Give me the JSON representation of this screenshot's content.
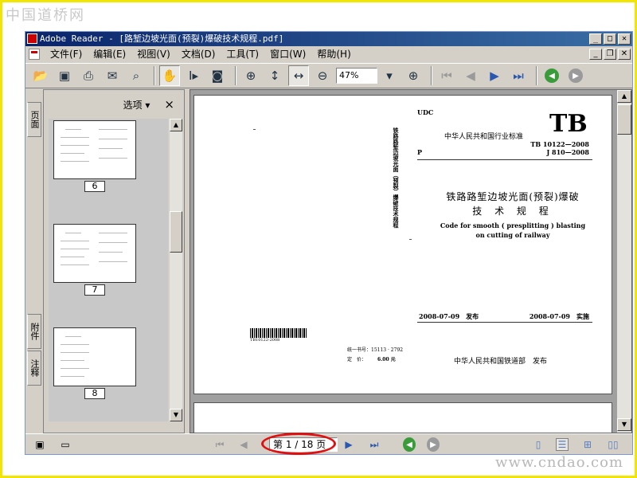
{
  "watermarks": {
    "top": "中国道桥网",
    "bottom": "www.cndao.com"
  },
  "window": {
    "title": "Adobe Reader - [路堑边坡光面(预裂)爆破技术规程.pdf]"
  },
  "menu": {
    "items": [
      "文件(F)",
      "编辑(E)",
      "视图(V)",
      "文档(D)",
      "工具(T)",
      "窗口(W)",
      "帮助(H)"
    ]
  },
  "toolbar": {
    "zoom_value": "47%",
    "icons": [
      "open-icon",
      "save-icon",
      "print-icon",
      "email-icon",
      "search-icon",
      "hand-icon",
      "select-text-icon",
      "snapshot-icon",
      "zoom-in-icon",
      "fit-page-icon",
      "fit-width-icon",
      "zoom-out-icon",
      "zoom-plus-icon",
      "first-page-icon",
      "prev-page-icon",
      "next-page-icon",
      "last-page-icon",
      "back-icon",
      "forward-icon"
    ]
  },
  "side_tabs": {
    "pages": "页面",
    "attachments": "附件",
    "comments": "注释"
  },
  "side_panel": {
    "options_label": "选项 ▾",
    "close": "×",
    "thumbnails": [
      "6",
      "7",
      "8"
    ]
  },
  "document": {
    "udc": "UDC",
    "standard": "中华人民共和国行业标准",
    "tb": "TB",
    "code1": "TB 10122—2008",
    "code2": "J 810—2008",
    "p": "P",
    "spine": "铁路路堑边坡光面（预裂）爆破技术规程",
    "title_cn_1": "铁路路堑边坡光面(预裂)爆破",
    "title_cn_2": "技 术 规 程",
    "title_en_1": "Code for smooth ( presplitting ) blasting",
    "title_en_2": "on cutting of railway",
    "publish_date": "2008-07-09　发布",
    "implement_date": "2008-07-09　实施",
    "barcode_text": "TB10122-2008",
    "isbn": "统一书号：15113 · 2792",
    "price_label": "定　价：",
    "price_value": "6.00 元",
    "publisher": "中华人民共和国铁道部　发布"
  },
  "status": {
    "page_indicator": "第 1 / 18 页"
  },
  "colors": {
    "title_start": "#0a246a",
    "title_end": "#3a6ea5",
    "highlight_oval": "#e01010",
    "border": "#f2e500",
    "nav_green": "#3a9b3a"
  }
}
